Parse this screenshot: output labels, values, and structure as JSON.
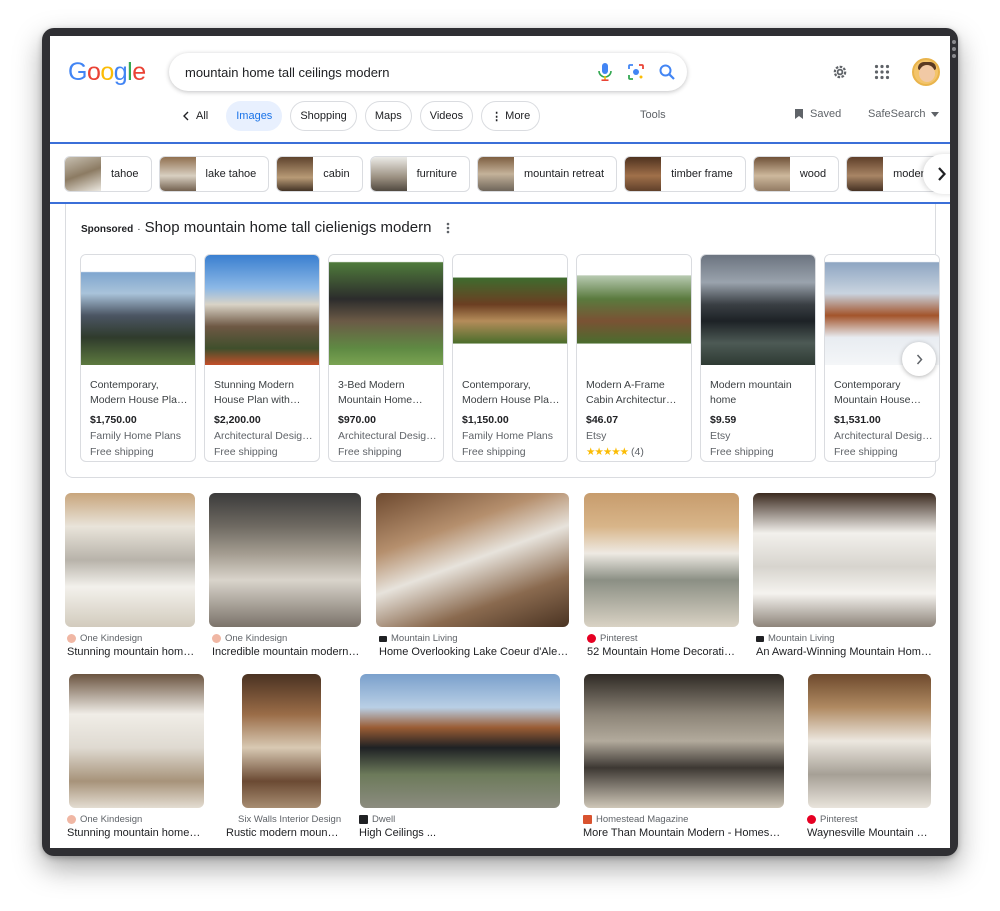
{
  "search": {
    "query": "mountain home tall ceilings modern"
  },
  "logo": {
    "letters": [
      "G",
      "o",
      "o",
      "g",
      "l",
      "e"
    ]
  },
  "tabs": {
    "back_label": "All",
    "items": [
      "Images",
      "Shopping",
      "Maps",
      "Videos",
      "More"
    ],
    "active": "Images",
    "tools": "Tools",
    "saved": "Saved",
    "safesearch": "SafeSearch"
  },
  "chips": [
    "tahoe",
    "lake tahoe",
    "cabin",
    "furniture",
    "mountain retreat",
    "timber frame",
    "wood",
    "modern rus"
  ],
  "sponsored": {
    "tag": "Sponsored",
    "separator": "·",
    "title": "Shop mountain home tall cielienigs modern",
    "products": [
      {
        "line1": "Contemporary,",
        "line2": "Modern House Pla…",
        "price": "$1,750.00",
        "seller": "Family Home Plans",
        "extra": "Free shipping"
      },
      {
        "line1": "Stunning Modern",
        "line2": "House Plan with…",
        "price": "$2,200.00",
        "seller": "Architectural Desig…",
        "extra": "Free shipping"
      },
      {
        "line1": "3-Bed Modern",
        "line2": "Mountain Home…",
        "price": "$970.00",
        "seller": "Architectural Desig…",
        "extra": "Free shipping"
      },
      {
        "line1": "Contemporary,",
        "line2": "Modern House Pla…",
        "price": "$1,150.00",
        "seller": "Family Home Plans",
        "extra": "Free shipping"
      },
      {
        "line1": "Modern A-Frame",
        "line2": "Cabin Architectur…",
        "price": "$46.07",
        "seller": "Etsy",
        "stars": "★★★★★",
        "reviews": "(4)"
      },
      {
        "line1": "Modern mountain",
        "line2": "home",
        "price": "$9.59",
        "seller": "Etsy",
        "extra": "Free shipping"
      },
      {
        "line1": "Contemporary",
        "line2": "Mountain House…",
        "price": "$1,531.00",
        "seller": "Architectural Desig…",
        "extra": "Free shipping"
      }
    ]
  },
  "results": [
    {
      "source": "One Kindesign",
      "caption": "Stunning mountain hom…"
    },
    {
      "source": "One Kindesign",
      "caption": "Incredible mountain modern …"
    },
    {
      "source": "Mountain Living",
      "caption": "Home Overlooking Lake Coeur d'Alen…"
    },
    {
      "source": "Pinterest",
      "caption": "52 Mountain Home Decoratin…"
    },
    {
      "source": "Mountain Living",
      "caption": "An Award-Winning Mountain Home…"
    },
    {
      "source": "One Kindesign",
      "caption": "Stunning mountain home i…"
    },
    {
      "source": "Six Walls Interior Design",
      "caption": "Rustic modern mount…"
    },
    {
      "source": "Dwell",
      "caption": "High Ceilings ..."
    },
    {
      "source": "Homestead Magazine",
      "caption": "More Than Mountain Modern - Homeste…"
    },
    {
      "source": "Pinterest",
      "caption": "Waynesville Mountain M…"
    }
  ],
  "colors": {
    "accent": "#1a73e8",
    "active_tab_bg": "#e8f0fe",
    "chip_border": "#3b6fd8",
    "star": "#fbbc04"
  }
}
